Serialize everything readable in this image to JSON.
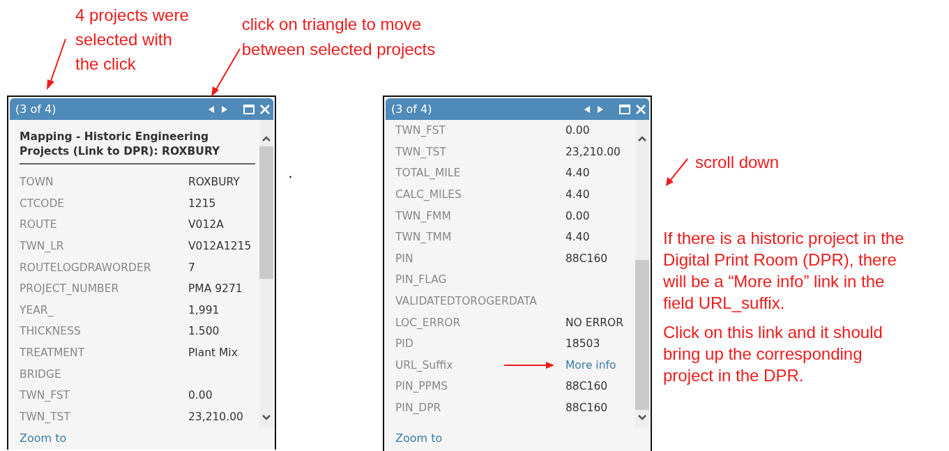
{
  "annotations": {
    "selected_note": [
      "4 projects were",
      "selected with",
      "the click"
    ],
    "triangle_note": [
      "click on triangle to move",
      "between selected projects"
    ],
    "scroll_note": "scroll down",
    "paragraphs": [
      [
        "If there is a historic project in the",
        "Digital Print Room (DPR), there",
        "will be a “More info” link in the",
        "field URL_suffix."
      ],
      [
        "Click on this link and it should",
        "bring up the corresponding",
        "project in the DPR."
      ]
    ],
    "stray_mark": "."
  },
  "popups": [
    {
      "counter": "(3 of 4)",
      "title": "Mapping - Historic Engineering Projects (Link to DPR): ROXBURY",
      "scrolled_to_end": false,
      "footer_link": "Zoom to",
      "rows": [
        {
          "label": "TOWN",
          "value": "ROXBURY",
          "kind": "text",
          "pointed": false
        },
        {
          "label": "CTCODE",
          "value": "1215",
          "kind": "text",
          "pointed": false
        },
        {
          "label": "ROUTE",
          "value": "V012A",
          "kind": "text",
          "pointed": false
        },
        {
          "label": "TWN_LR",
          "value": "V012A1215",
          "kind": "text",
          "pointed": false
        },
        {
          "label": "ROUTELOGDRAWORDER",
          "value": "7",
          "kind": "text",
          "pointed": false
        },
        {
          "label": "PROJECT_NUMBER",
          "value": "PMA 9271",
          "kind": "text",
          "pointed": false
        },
        {
          "label": "YEAR_",
          "value": "1,991",
          "kind": "text",
          "pointed": false
        },
        {
          "label": "THICKNESS",
          "value": "1.500",
          "kind": "text",
          "pointed": false
        },
        {
          "label": "TREATMENT",
          "value": "Plant Mix",
          "kind": "text",
          "pointed": false
        },
        {
          "label": "BRIDGE",
          "kind": "text",
          "pointed": false
        },
        {
          "label": "TWN_FST",
          "value": "0.00",
          "kind": "text",
          "pointed": false
        },
        {
          "label": "TWN_TST",
          "value": "23,210.00",
          "kind": "text",
          "pointed": false
        }
      ]
    },
    {
      "counter": "(3 of 4)",
      "scrolled_to_end": true,
      "footer_link": "Zoom to",
      "rows": [
        {
          "label": "TWN_FST",
          "value": "0.00",
          "kind": "text",
          "pointed": false
        },
        {
          "label": "TWN_TST",
          "value": "23,210.00",
          "kind": "text",
          "pointed": false
        },
        {
          "label": "TOTAL_MILE",
          "value": "4.40",
          "kind": "text",
          "pointed": false
        },
        {
          "label": "CALC_MILES",
          "value": "4.40",
          "kind": "text",
          "pointed": false
        },
        {
          "label": "TWN_FMM",
          "value": "0.00",
          "kind": "text",
          "pointed": false
        },
        {
          "label": "TWN_TMM",
          "value": "4.40",
          "kind": "text",
          "pointed": false
        },
        {
          "label": "PIN",
          "value": "88C160",
          "kind": "text",
          "pointed": false
        },
        {
          "label": "PIN_FLAG",
          "kind": "text",
          "pointed": false
        },
        {
          "label": "VALIDATEDTOROGERDATA",
          "kind": "text",
          "pointed": false
        },
        {
          "label": "LOC_ERROR",
          "value": "NO ERROR",
          "kind": "text",
          "pointed": false
        },
        {
          "label": "PID",
          "value": "18503",
          "kind": "text",
          "pointed": false
        },
        {
          "label": "URL_Suffix",
          "value": "More info",
          "kind": "link",
          "pointed": true
        },
        {
          "label": "PIN_PPMS",
          "value": "88C160",
          "kind": "text",
          "pointed": false
        },
        {
          "label": "PIN_DPR",
          "value": "88C160",
          "kind": "text",
          "pointed": false
        }
      ]
    }
  ]
}
